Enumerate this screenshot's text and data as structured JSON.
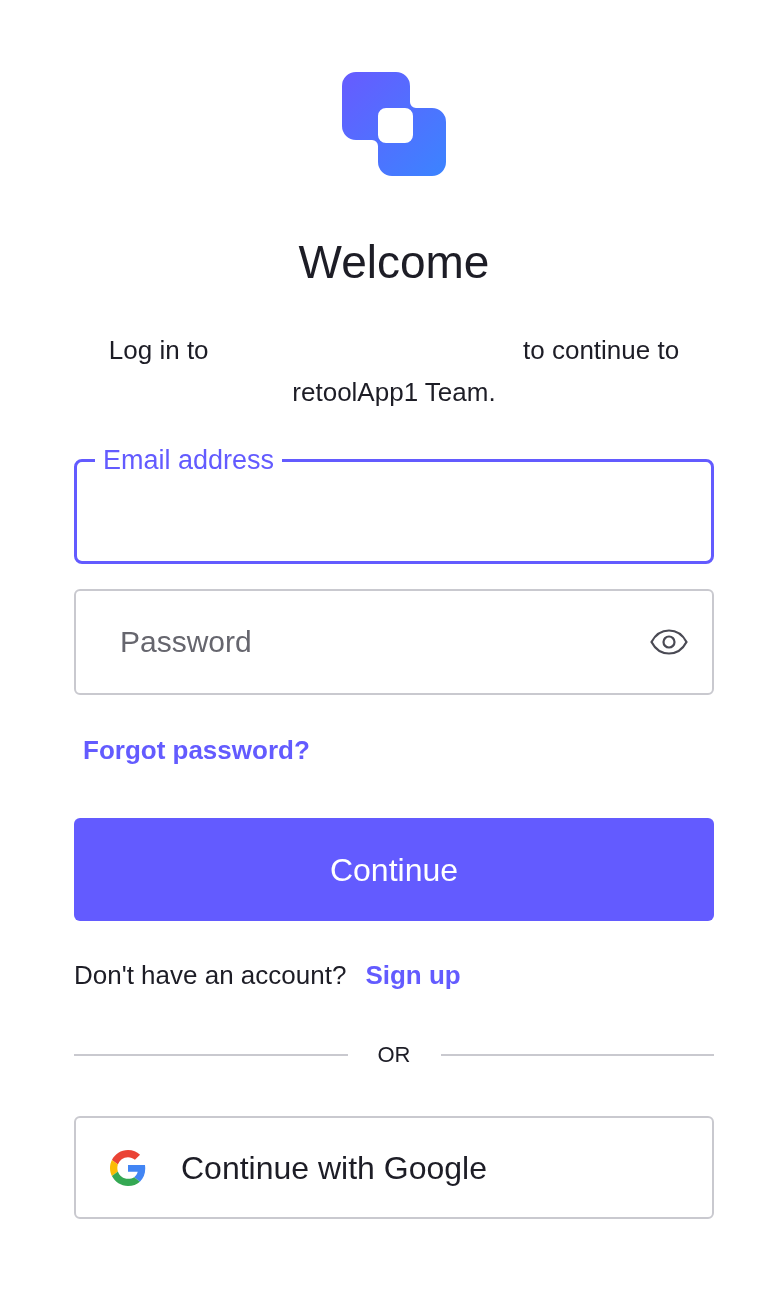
{
  "title": "Welcome",
  "intro": {
    "lead": "Log in to",
    "trail": "to continue to retoolApp1 Team."
  },
  "email_field": {
    "label": "Email address",
    "focused": true
  },
  "password_field": {
    "placeholder": "Password"
  },
  "forgot_link": "Forgot password?",
  "continue_button": "Continue",
  "signup": {
    "prompt": "Don't have an account?",
    "link": "Sign up"
  },
  "divider": "OR",
  "google_button": "Continue with Google"
}
